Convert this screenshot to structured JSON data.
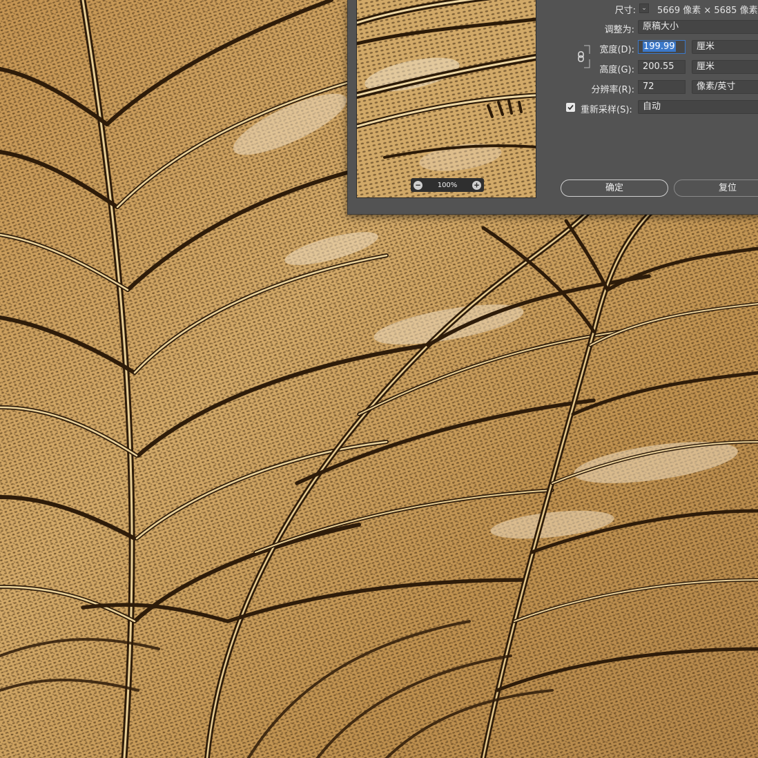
{
  "dialog": {
    "size": {
      "label": "尺寸:",
      "value": "5669 像素 × 5685 像素"
    },
    "fit_to": {
      "label": "调整为:",
      "value": "原稿大小"
    },
    "width": {
      "label": "宽度(D):",
      "value": "199.99",
      "unit": "厘米"
    },
    "height": {
      "label": "高度(G):",
      "value": "200.55",
      "unit": "厘米"
    },
    "resolution": {
      "label": "分辨率(R):",
      "value": "72",
      "unit": "像素/英寸"
    },
    "resample": {
      "label": "重新采样(S):",
      "checked": true,
      "value": "自动"
    },
    "preview_zoom": "100%",
    "ok_label": "确定",
    "reset_label": "复位"
  },
  "icons": {
    "link": "chain-link-icon",
    "zoom_out": "minus-circle-icon",
    "zoom_in": "plus-circle-icon",
    "check": "checkmark-icon",
    "dropdown": "chevron-down-icon"
  },
  "colors": {
    "dialog_bg": "#535353",
    "highlight": "#3b78c9",
    "artwork_gold": "#c89a58",
    "artwork_dark": "#3a2612"
  }
}
